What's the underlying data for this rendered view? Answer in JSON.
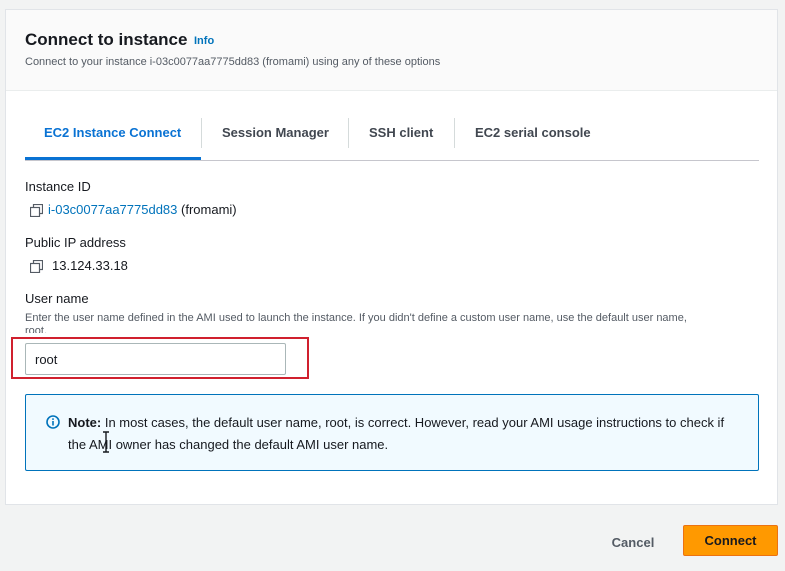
{
  "dialog": {
    "title": "Connect to instance",
    "info_label": "Info",
    "subtitle": "Connect to your instance i-03c0077aa7775dd83 (fromami) using any of these options"
  },
  "tabs": [
    {
      "label": "EC2 Instance Connect",
      "active": true
    },
    {
      "label": "Session Manager",
      "active": false
    },
    {
      "label": "SSH client",
      "active": false
    },
    {
      "label": "EC2 serial console",
      "active": false
    }
  ],
  "instance": {
    "id_label": "Instance ID",
    "id_value": "i-03c0077aa7775dd83",
    "id_suffix": "(fromami)",
    "ip_label": "Public IP address",
    "ip_value": "13.124.33.18"
  },
  "username": {
    "label": "User name",
    "description": "Enter the user name defined in the AMI used to launch the instance. If you didn't define a custom user name, use the default user name,",
    "description_cont": "root.",
    "value": "root"
  },
  "alert": {
    "icon": "info-circle-icon",
    "strong": "Note:",
    "text": " In most cases, the default user name, root, is correct. However, read your AMI usage instructions to check if the AMI owner has changed the default AMI user name."
  },
  "footer": {
    "cancel_label": "Cancel",
    "connect_label": "Connect"
  },
  "colors": {
    "accent": "#0972d3",
    "primary_button": "#ff9900",
    "highlight_box": "#d0202e",
    "alert_bg": "#f1faff"
  }
}
